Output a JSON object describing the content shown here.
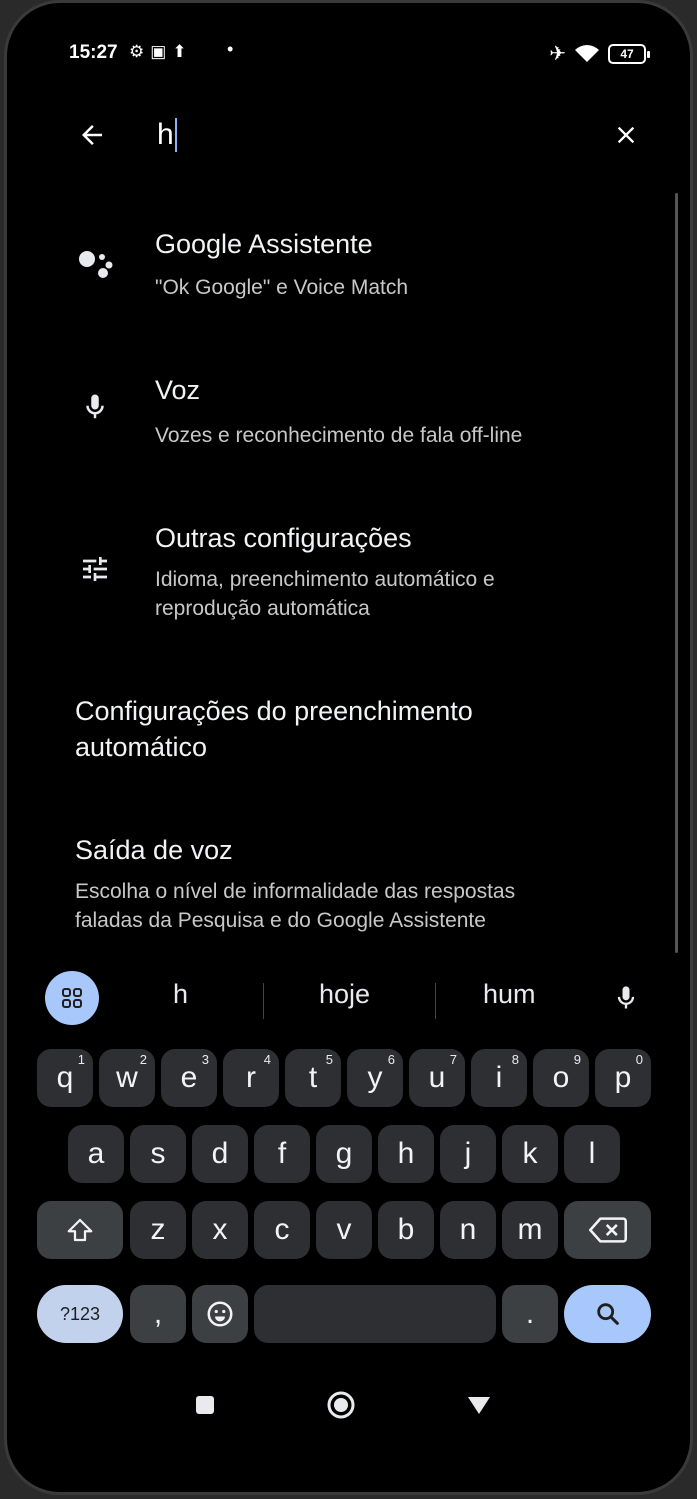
{
  "status_bar": {
    "time": "15:27",
    "left_icons": [
      "settings-icon",
      "app-notification-icon",
      "upload-icon"
    ],
    "dot": "•",
    "right_icons": [
      "airplane-icon",
      "wifi-icon"
    ],
    "battery": "47"
  },
  "search": {
    "query": "h"
  },
  "results": [
    {
      "title": "Google Assistente",
      "subtitle": "\"Ok Google\" e Voice Match",
      "icon": "google-assistant-icon"
    },
    {
      "title": "Voz",
      "subtitle": "Vozes e reconhecimento de fala off-line",
      "icon": "mic-icon"
    },
    {
      "title": "Outras configurações",
      "subtitle": "Idioma, preenchimento automático e reprodução automática",
      "icon": "tune-icon"
    },
    {
      "title": "Configurações do preenchimento automático",
      "subtitle": "",
      "icon": ""
    },
    {
      "title": "Saída de voz",
      "subtitle": "Escolha o nível de informalidade das respostas faladas da Pesquisa e do Google Assistente",
      "icon": ""
    }
  ],
  "suggestions": {
    "words": [
      "h",
      "hoje",
      "hum"
    ]
  },
  "keyboard": {
    "row1": [
      [
        "q",
        "1"
      ],
      [
        "w",
        "2"
      ],
      [
        "e",
        "3"
      ],
      [
        "r",
        "4"
      ],
      [
        "t",
        "5"
      ],
      [
        "y",
        "6"
      ],
      [
        "u",
        "7"
      ],
      [
        "i",
        "8"
      ],
      [
        "o",
        "9"
      ],
      [
        "p",
        "0"
      ]
    ],
    "row2": [
      "a",
      "s",
      "d",
      "f",
      "g",
      "h",
      "j",
      "k",
      "l"
    ],
    "row3": [
      "z",
      "x",
      "c",
      "v",
      "b",
      "n",
      "m"
    ],
    "symbols_label": "?123",
    "comma": ",",
    "period": "."
  },
  "colors": {
    "background": "#000000",
    "key": "#2d2f33",
    "accent": "#a8c7fa"
  }
}
